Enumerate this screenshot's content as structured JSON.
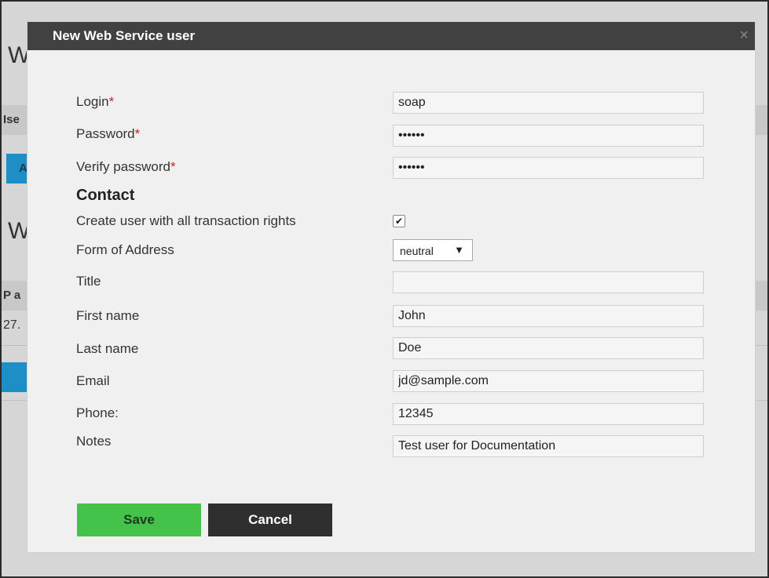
{
  "background": {
    "heading_1": "W",
    "bar_1_text": "Ise",
    "blue_btn_1": "A",
    "heading_2": "W",
    "bar_2_text": "P a",
    "row_value": "27."
  },
  "dialog": {
    "title": "New Web Service user",
    "close_symbol": "×",
    "login_label": "Login",
    "login_value": "soap",
    "password_label": "Password",
    "password_value": "soapws",
    "verify_label": "Verify password",
    "verify_value": "soapws",
    "required_mark": "*",
    "contact_heading": "Contact",
    "rights_label": "Create user with all transaction rights",
    "rights_checked": true,
    "check_symbol": "✔",
    "address_label": "Form of Address",
    "address_value": "neutral",
    "caret_symbol": "▼",
    "title_label": "Title",
    "title_value": "",
    "firstname_label": "First name",
    "firstname_value": "John",
    "lastname_label": "Last name",
    "lastname_value": "Doe",
    "email_label": "Email",
    "email_value": "jd@sample.com",
    "phone_label": "Phone:",
    "phone_value": "12345",
    "notes_label": "Notes",
    "notes_value": "Test user for Documentation",
    "save_label": "Save",
    "cancel_label": "Cancel"
  },
  "colors": {
    "titlebar": "#414141",
    "save_button": "#44c24a",
    "cancel_button": "#2f2f2f",
    "required": "#d02020",
    "background_blue": "#1e8fc6"
  }
}
